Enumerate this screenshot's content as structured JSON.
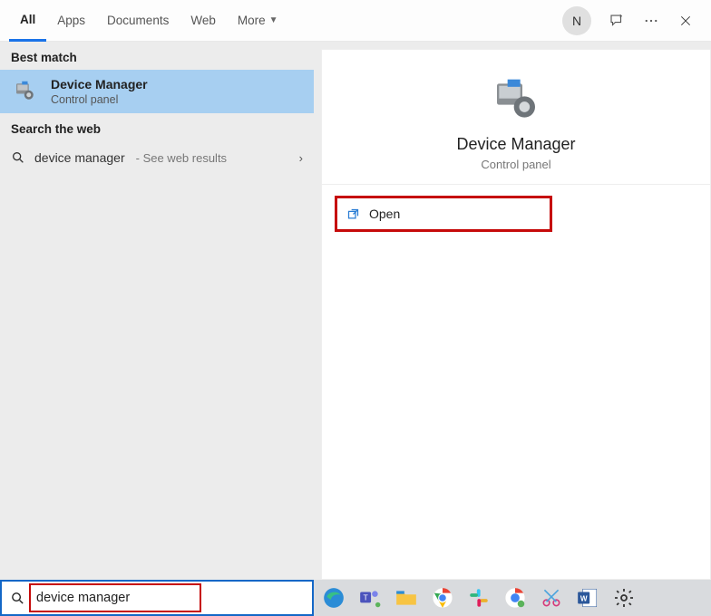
{
  "tabs": {
    "all": "All",
    "apps": "Apps",
    "documents": "Documents",
    "web": "Web",
    "more": "More"
  },
  "avatar_letter": "N",
  "left": {
    "best_match": "Best match",
    "result_title": "Device Manager",
    "result_sub": "Control panel",
    "search_web": "Search the web",
    "web_query": "device manager",
    "web_hint": "- See web results"
  },
  "detail": {
    "title": "Device Manager",
    "sub": "Control panel",
    "open": "Open"
  },
  "search_value": "device manager"
}
